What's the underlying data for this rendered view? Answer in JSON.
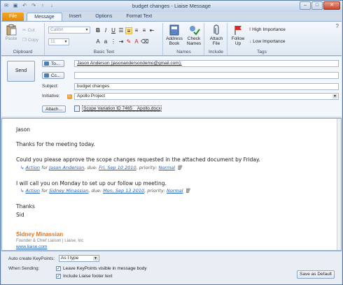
{
  "window": {
    "title": "budget changes - Liaise Message"
  },
  "tabs": [
    {
      "label": "File"
    },
    {
      "label": "Message"
    },
    {
      "label": "Insert"
    },
    {
      "label": "Options"
    },
    {
      "label": "Format Text"
    }
  ],
  "ribbon": {
    "clipboard": {
      "label": "Clipboard",
      "paste": "Paste",
      "cut": "Cut",
      "copy": "Copy"
    },
    "basic_text": {
      "label": "Basic Text",
      "font": "Calibri",
      "size": "11"
    },
    "names": {
      "label": "Names",
      "address_book": "Address Book",
      "check_names": "Check Names"
    },
    "include": {
      "label": "Include",
      "attach_file": "Attach File"
    },
    "tags": {
      "label": "Tags",
      "follow_up": "Follow Up",
      "high": "High Importance",
      "low": "Low Importance"
    }
  },
  "header": {
    "send": "Send",
    "to_btn": "To...",
    "cc_btn": "Cc...",
    "to_value": "Jason Anderson (jasonandersondemo@gmail.com);",
    "cc_value": "",
    "subject_label": "Subject:",
    "subject_value": "budget changes",
    "initiative_label": "Initiative:",
    "initiative_value": "Apollo Project",
    "attach_btn": "Attach...",
    "attachment": "Scope Variation ID 7465 _ Apollo.docx"
  },
  "body": {
    "greeting": "Jason",
    "line1": "Thanks for the meeting today.",
    "line2": "Could you please approve the scope changes requested in the attached document by Friday.",
    "kp1": {
      "action": "Action",
      "for": "for",
      "who": "Jason Anderson",
      "due_label": ", due:",
      "due": "Fri, Sep 10 2010",
      "pri_label": ", priority:",
      "priority": "Normal"
    },
    "line3": "I will call you on Monday to set up our follow up meeting.",
    "kp2": {
      "action": "Action",
      "for": "for",
      "who": "Sidney Minassian",
      "due_label": ", due:",
      "due": "Mon, Sep 13 2010",
      "pri_label": ", priority:",
      "priority": "Normal"
    },
    "thanks": "Thanks",
    "sid": "Sid",
    "sig_name": "Sidney Minassian",
    "sig_title": "Founder & Chief Liaison | Liaise, Inc",
    "sig_web": "www.liaise.com"
  },
  "footer": {
    "auto_label": "Auto create KeyPoints:",
    "auto_value": "As I type",
    "when_sending": "When Sending:",
    "opt1": "Leave KeyPoints visible in message body",
    "opt2": "Include Liaise footer text",
    "save_default": "Save as Default"
  },
  "colors": {
    "accent": "#e3731d",
    "link": "#1f5fbf",
    "file_tab": "#f5a623"
  }
}
